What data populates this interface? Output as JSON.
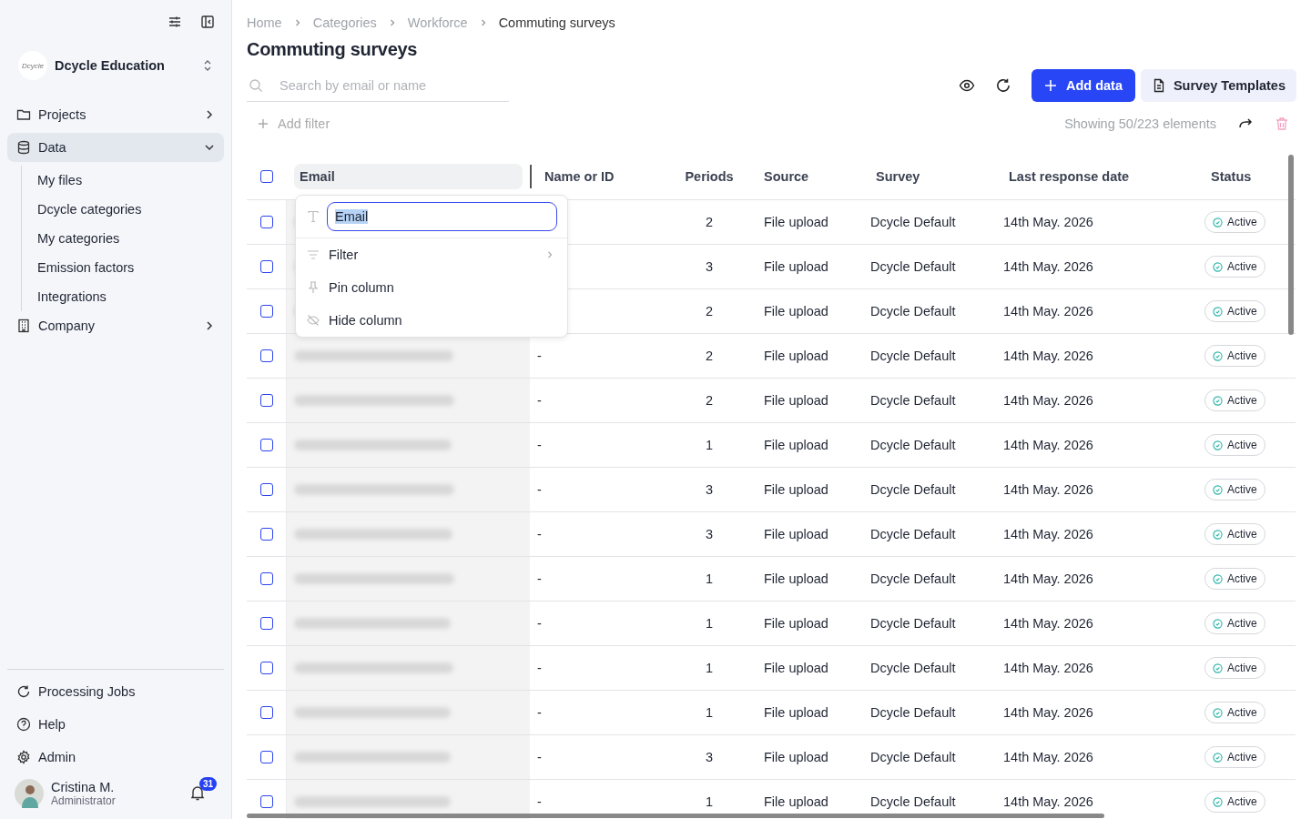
{
  "sidebar": {
    "org": {
      "logo_text": "Dcycle",
      "name": "Dcycle Education"
    },
    "nav": [
      {
        "label": "Projects",
        "selected": false,
        "expanded": false
      },
      {
        "label": "Data",
        "selected": true,
        "expanded": true,
        "children": [
          {
            "label": "My files",
            "selected": false
          },
          {
            "label": "Dcycle categories",
            "selected": false
          },
          {
            "label": "My categories",
            "selected": false
          },
          {
            "label": "Emission factors",
            "selected": false
          },
          {
            "label": "Integrations",
            "selected": false
          }
        ]
      },
      {
        "label": "Company",
        "selected": false,
        "expanded": false
      }
    ],
    "bottom": [
      {
        "label": "Processing Jobs"
      },
      {
        "label": "Help"
      },
      {
        "label": "Admin"
      }
    ],
    "user": {
      "name": "Cristina M.",
      "role": "Administrator",
      "notifications": "31"
    }
  },
  "breadcrumbs": [
    "Home",
    "Categories",
    "Workforce",
    "Commuting surveys"
  ],
  "title": "Commuting surveys",
  "search": {
    "placeholder": "Search by email or name"
  },
  "buttons": {
    "add": "Add data",
    "templates": "Survey Templates"
  },
  "add_filter": "Add filter",
  "showing": "Showing 50/223 elements",
  "table": {
    "all_checked": false,
    "columns": [
      {
        "label": "Email",
        "selected": true
      },
      {
        "label": "Name or ID",
        "selected": false
      },
      {
        "label": "Periods",
        "selected": false
      },
      {
        "label": "Source",
        "selected": false
      },
      {
        "label": "Survey",
        "selected": false
      },
      {
        "label": "Last response date",
        "selected": false
      },
      {
        "label": "Status",
        "selected": false
      }
    ],
    "column_menu": {
      "value": "Email",
      "items": [
        {
          "label": "Filter",
          "kind": "submenu"
        },
        {
          "label": "Pin column",
          "kind": "action"
        },
        {
          "label": "Hide column",
          "kind": "action"
        }
      ]
    },
    "rows": [
      {
        "checked": false,
        "periods": "2",
        "source": "File upload",
        "survey": "Dcycle Default",
        "date": "14th May. 2026",
        "status": "Active"
      },
      {
        "checked": false,
        "periods": "3",
        "source": "File upload",
        "survey": "Dcycle Default",
        "date": "14th May. 2026",
        "status": "Active"
      },
      {
        "checked": false,
        "periods": "2",
        "source": "File upload",
        "survey": "Dcycle Default",
        "date": "14th May. 2026",
        "status": "Active"
      },
      {
        "checked": false,
        "name": "-",
        "periods": "2",
        "source": "File upload",
        "survey": "Dcycle Default",
        "date": "14th May. 2026",
        "status": "Active"
      },
      {
        "checked": false,
        "name": "-",
        "periods": "2",
        "source": "File upload",
        "survey": "Dcycle Default",
        "date": "14th May. 2026",
        "status": "Active"
      },
      {
        "checked": false,
        "name": "-",
        "periods": "1",
        "source": "File upload",
        "survey": "Dcycle Default",
        "date": "14th May. 2026",
        "status": "Active"
      },
      {
        "checked": false,
        "name": "-",
        "periods": "3",
        "source": "File upload",
        "survey": "Dcycle Default",
        "date": "14th May. 2026",
        "status": "Active"
      },
      {
        "checked": false,
        "name": "-",
        "periods": "3",
        "source": "File upload",
        "survey": "Dcycle Default",
        "date": "14th May. 2026",
        "status": "Active"
      },
      {
        "checked": false,
        "name": "-",
        "periods": "1",
        "source": "File upload",
        "survey": "Dcycle Default",
        "date": "14th May. 2026",
        "status": "Active"
      },
      {
        "checked": false,
        "name": "-",
        "periods": "1",
        "source": "File upload",
        "survey": "Dcycle Default",
        "date": "14th May. 2026",
        "status": "Active"
      },
      {
        "checked": false,
        "name": "-",
        "periods": "1",
        "source": "File upload",
        "survey": "Dcycle Default",
        "date": "14th May. 2026",
        "status": "Active"
      },
      {
        "checked": false,
        "name": "-",
        "periods": "1",
        "source": "File upload",
        "survey": "Dcycle Default",
        "date": "14th May. 2026",
        "status": "Active"
      },
      {
        "checked": false,
        "name": "-",
        "periods": "3",
        "source": "File upload",
        "survey": "Dcycle Default",
        "date": "14th May. 2026",
        "status": "Active"
      },
      {
        "checked": false,
        "name": "-",
        "periods": "1",
        "source": "File upload",
        "survey": "Dcycle Default",
        "date": "14th May. 2026",
        "status": "Active"
      }
    ]
  }
}
